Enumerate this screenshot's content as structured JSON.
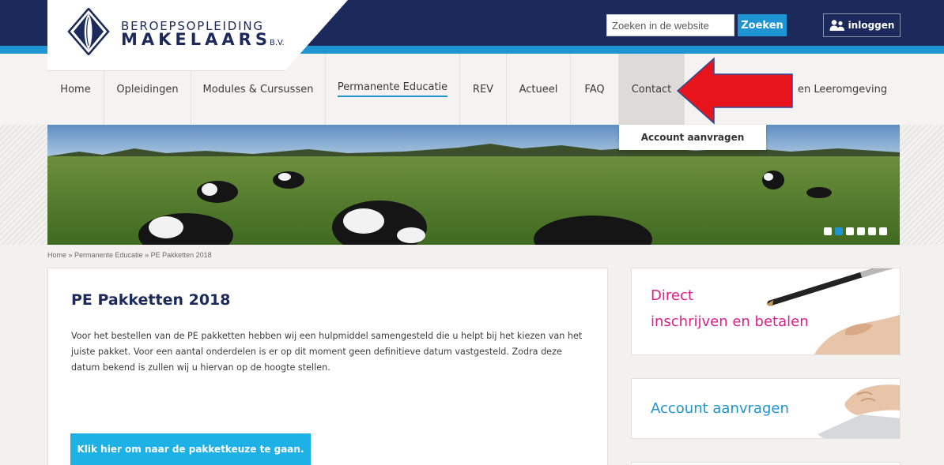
{
  "header": {
    "logo_line1": "BEROEPSOPLEIDING",
    "logo_line2": "MAKELAARS",
    "logo_suffix": "B.V.",
    "search_placeholder": "Zoeken in de website",
    "search_button": "Zoeken",
    "login_button": "inloggen"
  },
  "nav": {
    "items": [
      {
        "label": "Home"
      },
      {
        "label": "Opleidingen"
      },
      {
        "label": "Modules & Cursussen"
      },
      {
        "label": "Permanente Educatie"
      },
      {
        "label": "REV"
      },
      {
        "label": "Actueel"
      },
      {
        "label": "FAQ"
      },
      {
        "label": "Contact"
      }
    ],
    "partial_item": "en Leeromgeving",
    "dropdown_item": "Account aanvragen"
  },
  "banner": {
    "slides": 6,
    "active_slide": 2
  },
  "breadcrumb": "Home » Permanente Educatie » PE Pakketten 2018",
  "content": {
    "title": "PE Pakketten 2018",
    "text": "Voor het bestellen van de PE pakketten hebben wij een hulpmiddel samengesteld die u helpt bij het kiezen van het juiste pakket. Voor een aantal onderdelen is er op dit moment geen definitieve datum vastgesteld. Zodra deze datum bekend is zullen wij u hiervan op de hoogte stellen.",
    "cta_button": "Klik hier om naar de pakketkeuze te gaan."
  },
  "sidebar": {
    "promo1_line1": "Direct",
    "promo1_line2": "inschrijven en betalen",
    "promo2": "Account aanvragen"
  },
  "colors": {
    "navy": "#1b2a5a",
    "blue": "#1e94d2",
    "magenta": "#d91f8b",
    "arrow": "#e8141b"
  }
}
